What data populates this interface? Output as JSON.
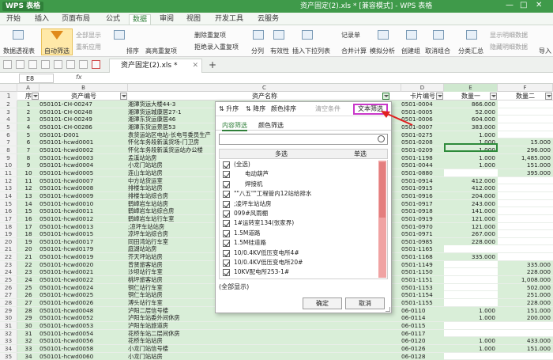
{
  "app": {
    "logo": "WPS 表格",
    "doc_title": "资产固定(2).xls * [兼容模式] - WPS 表格"
  },
  "menu": [
    "开始",
    "插入",
    "页面布局",
    "公式",
    "数据",
    "审阅",
    "视图",
    "开发工具",
    "云服务"
  ],
  "menu_active": 4,
  "ribbon": {
    "pivot": "数据透视表",
    "autofilter": "自动筛选",
    "show_all": "全部显示",
    "reapply": "重新应用",
    "sort": "排序",
    "highlight_dup": "高亮重复项",
    "delete_dup": "删除重复项",
    "reject_dup": "拒绝录入重复项",
    "split": "分列",
    "validity": "有效性",
    "insert_dropdown": "插入下拉列表",
    "record": "记录单",
    "consolidate": "合并计算",
    "simulate": "模拟分析",
    "group": "创建组",
    "ungroup": "取消组合",
    "subtotal": "分类汇总",
    "show_detail": "显示明细数据",
    "hide_detail": "隐藏明细数据",
    "import": "导入"
  },
  "doc_tab": "资产固定(2).xls *",
  "namebox": "E8",
  "fx": "fx",
  "columns": [
    "A",
    "B",
    "C",
    "D",
    "E",
    "F"
  ],
  "headers": {
    "seq": "序",
    "asset_code": "资产编号",
    "asset_name": "资产名称",
    "card": "卡片编号",
    "qty1": "数量一",
    "qty2": "数量二"
  },
  "rows": [
    {
      "n": "2",
      "s": "1",
      "code": "050101-CH-00247",
      "name": "湘潭货运大楼44-3",
      "card": "0501-0004",
      "q1": "866.000",
      "q2": ""
    },
    {
      "n": "3",
      "s": "2",
      "code": "050101-CH-00248",
      "name": "湘潭货运城康居27-1",
      "card": "0501-0005",
      "q1": "52.000",
      "q2": ""
    },
    {
      "n": "4",
      "s": "3",
      "code": "050101-CH-00249",
      "name": "湘潭东货运康居46",
      "card": "0501-0006",
      "q1": "604.000",
      "q2": ""
    },
    {
      "n": "5",
      "s": "4",
      "code": "050101-CH-00286",
      "name": "湘潭东货运景居53",
      "card": "0501-0007",
      "q1": "383.000",
      "q2": ""
    },
    {
      "n": "6",
      "s": "5",
      "code": "050101-D001",
      "name": "袁货运站区电站-长电号委员生产",
      "card": "0501-0275",
      "q1": "1.000",
      "q2": ""
    },
    {
      "n": "7",
      "s": "6",
      "code": "050101-hcwd0001",
      "name": "怀化车务段新溪货场-门卫房",
      "card": "0501-0208",
      "q1": "1.000",
      "q2": "15.000"
    },
    {
      "n": "8",
      "s": "7",
      "code": "050101-hcwd0002",
      "name": "怀化车务段新溪货运站办公楼",
      "card": "0501-0209",
      "q1": "1.000",
      "q2": "296.000"
    },
    {
      "n": "9",
      "s": "8",
      "code": "050101-hcwd0003",
      "name": "孟溪站站房",
      "card": "0501-1198",
      "q1": "1.000",
      "q2": "1,485.000"
    },
    {
      "n": "10",
      "s": "9",
      "code": "050101-hcwd0004",
      "name": "小龙门站站房",
      "card": "0501-0044",
      "q1": "1.000",
      "q2": "151.000"
    },
    {
      "n": "11",
      "s": "10",
      "code": "050101-hcwd0005",
      "name": "连山车站站房",
      "card": "0501-0880",
      "q1": "",
      "q2": "395.000"
    },
    {
      "n": "12",
      "s": "11",
      "code": "050101-hcwd0007",
      "name": "中方站货运室",
      "card": "0501-0914",
      "q1": "412.000",
      "q2": ""
    },
    {
      "n": "13",
      "s": "12",
      "code": "050101-hcwd0008",
      "name": "排楼车站站房",
      "card": "0501-0915",
      "q1": "412.000",
      "q2": ""
    },
    {
      "n": "14",
      "s": "13",
      "code": "050101-hcwd0009",
      "name": "排楼车站综合房",
      "card": "0501-0916",
      "q1": "204.000",
      "q2": ""
    },
    {
      "n": "15",
      "s": "14",
      "code": "050101-hcwd0010",
      "name": "鹤嶂岩车站站房",
      "card": "0501-0917",
      "q1": "243.000",
      "q2": ""
    },
    {
      "n": "16",
      "s": "15",
      "code": "050101-hcwd0011",
      "name": "鹤嶂岩车站综合房",
      "card": "0501-0918",
      "q1": "141.000",
      "q2": ""
    },
    {
      "n": "17",
      "s": "16",
      "code": "050101-hcwd0012",
      "name": "鹤嶂岩车站行车室",
      "card": "0501-0919",
      "q1": "121.000",
      "q2": ""
    },
    {
      "n": "18",
      "s": "17",
      "code": "050101-hcwd0013",
      "name": ";凉坪车站站房",
      "card": "0501-0970",
      "q1": "121.000",
      "q2": ""
    },
    {
      "n": "19",
      "s": "18",
      "code": "050101-hcwd0015",
      "name": "凉坪车站综合房",
      "card": "0501-0971",
      "q1": "267.000",
      "q2": ""
    },
    {
      "n": "20",
      "s": "19",
      "code": "050101-hcwd0017",
      "name": "同田湾站行车室",
      "card": "0501-0985",
      "q1": "228.000",
      "q2": ""
    },
    {
      "n": "21",
      "s": "20",
      "code": "050101-hcwd0179",
      "name": "庭湖站站房",
      "card": "0501-1165",
      "q1": "",
      "q2": ""
    },
    {
      "n": "22",
      "s": "21",
      "code": "050101-hcwd0019",
      "name": "芥天坪站站房",
      "card": "0501-1168",
      "q1": "335.000",
      "q2": ""
    },
    {
      "n": "23",
      "s": "22",
      "code": "050101-hcwd0020",
      "name": "曾贤旅客站房",
      "card": "0501-1149",
      "q1": "",
      "q2": "335.000"
    },
    {
      "n": "24",
      "s": "23",
      "code": "050101-hcwd0021",
      "name": "沙坝站行车室",
      "card": "0501-1150",
      "q1": "",
      "q2": "228.000"
    },
    {
      "n": "25",
      "s": "24",
      "code": "050101-hcwd0022",
      "name": "桃坪旅客站房",
      "card": "0501-1151",
      "q1": "",
      "q2": "1,008.000"
    },
    {
      "n": "26",
      "s": "25",
      "code": "050101-hcwd0024",
      "name": "铜仁站行车室",
      "card": "0501-1153",
      "q1": "",
      "q2": "502.000"
    },
    {
      "n": "27",
      "s": "26",
      "code": "050101-hcwd0025",
      "name": "铜仁车站站房",
      "card": "0501-1154",
      "q1": "",
      "q2": "251.000"
    },
    {
      "n": "28",
      "s": "27",
      "code": "050101-hcwd0026",
      "name": "溥头站行车室",
      "card": "0501-1155",
      "q1": "",
      "q2": "228.000"
    },
    {
      "n": "29",
      "s": "28",
      "code": "050101-hcwd0048",
      "name": "泸阳二层信号楼",
      "card": "06-0110",
      "q1": "1.000",
      "q2": "151.000"
    },
    {
      "n": "30",
      "s": "29",
      "code": "050101-hcwd0052",
      "name": "泸阳车站委外间休房",
      "card": "06-0114",
      "q1": "1.000",
      "q2": "200.000"
    },
    {
      "n": "31",
      "s": "30",
      "code": "050101-hcwd0053",
      "name": "泸阳车站旅道房",
      "card": "06-0115",
      "q1": "",
      "q2": ""
    },
    {
      "n": "32",
      "s": "31",
      "code": "050101-hcwd0054",
      "name": "花桥车站二层间休房",
      "card": "06-0117",
      "q1": "",
      "q2": ""
    },
    {
      "n": "33",
      "s": "32",
      "code": "050101-hcwd0056",
      "name": "花桥车站站房",
      "card": "06-0120",
      "q1": "1.000",
      "q2": "433.000"
    },
    {
      "n": "34",
      "s": "33",
      "code": "050101-hcwd0058",
      "name": "小龙门站信号楼",
      "card": "06-0126",
      "q1": "1.000",
      "q2": "151.000"
    },
    {
      "n": "35",
      "s": "34",
      "code": "050101-hcwd0060",
      "name": "小龙门站站房",
      "card": "06-0128",
      "q1": "",
      "q2": ""
    }
  ],
  "filter": {
    "asc": "升序",
    "desc": "降序",
    "color_sort": "颜色排序",
    "clear": "清空条件",
    "text_filter": "文本筛选",
    "tab_content": "内容筛选",
    "tab_color": "颜色筛选",
    "search_value": "",
    "col_multi": "多选",
    "col_single": "单选",
    "items": [
      "(全选)",
      "电动葫芦",
      "焊接机",
      "\"\"八五\"\"工程管内12站给排水",
      ";凌坪车站站房",
      "099#风雨棚",
      "1#运转室134(张家界)",
      "1.5M道路",
      "1.5M硅道路",
      "10/0.4KV低压变电所4#",
      "10/0.4KV低压变电所20#",
      "10KV配电所253-1#",
      "10韶山16户住宅"
    ],
    "show_all": "(全部显示)",
    "ok": "确定",
    "cancel": "取消"
  },
  "colors": {
    "title_green": "#3f9a4a",
    "row_green": "#d9eed8",
    "highlight_pink": "#c938c9",
    "arrow_red": "#e02020",
    "scroll_pink": "#f0a3a3"
  }
}
